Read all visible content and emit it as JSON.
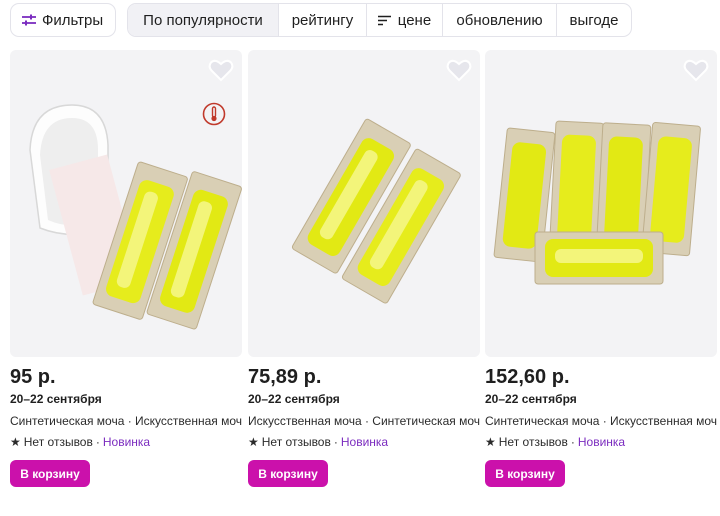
{
  "toolbar": {
    "filters_label": "Фильтры",
    "sort_options": [
      "По популярности",
      "рейтингу",
      "цене",
      "обновлению",
      "выгоде"
    ],
    "active_sort": "По популярности"
  },
  "colors": {
    "accent": "#cb11ab",
    "new_badge": "#7b2cbf",
    "card_bg": "#f3f3f5"
  },
  "products": [
    {
      "price": "95 р.",
      "delivery": "20–22 сентября",
      "title": "Синтетическая моча · Искусственная моча",
      "reviews": "Нет отзывов",
      "badge": "Новинка",
      "cart_label": "В корзину",
      "fav_icon": "heart-outline-icon",
      "extra_icon": "thermometer-icon"
    },
    {
      "price": "75,89 р.",
      "delivery": "20–22 сентября",
      "title": "Искусственная моча · Синтетическая моча",
      "reviews": "Нет отзывов",
      "badge": "Новинка",
      "cart_label": "В корзину",
      "fav_icon": "heart-outline-icon"
    },
    {
      "price": "152,60 р.",
      "delivery": "20–22 сентября",
      "title": "Синтетическая моча · Искусственная моча",
      "reviews": "Нет отзывов",
      "badge": "Новинка",
      "cart_label": "В корзину",
      "fav_icon": "heart-outline-icon"
    }
  ]
}
